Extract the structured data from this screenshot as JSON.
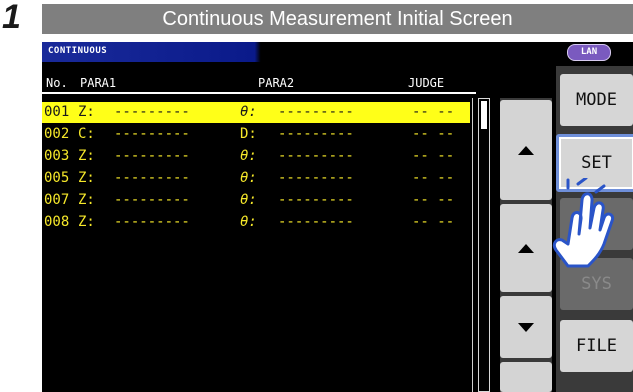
{
  "step": {
    "number": "1",
    "caption": "Continuous Measurement Initial Screen"
  },
  "titlebar": {
    "title": "CONTINUOUS",
    "lan_badge": "LAN"
  },
  "table": {
    "headers": {
      "no": "No.",
      "para1": "PARA1",
      "para2": "PARA2",
      "judge": "JUDGE"
    },
    "rows": [
      {
        "no": "001",
        "p1": "Z:",
        "v1": "---------",
        "p2": "θ:",
        "v2": "---------",
        "j": "-- --",
        "selected": true
      },
      {
        "no": "002",
        "p1": "C:",
        "v1": "---------",
        "p2": "D:",
        "v2": "---------",
        "j": "-- --",
        "selected": false
      },
      {
        "no": "003",
        "p1": "Z:",
        "v1": "---------",
        "p2": "θ:",
        "v2": "---------",
        "j": "-- --",
        "selected": false
      },
      {
        "no": "005",
        "p1": "Z:",
        "v1": "---------",
        "p2": "θ:",
        "v2": "---------",
        "j": "-- --",
        "selected": false
      },
      {
        "no": "007",
        "p1": "Z:",
        "v1": "---------",
        "p2": "θ:",
        "v2": "---------",
        "j": "-- --",
        "selected": false
      },
      {
        "no": "008",
        "p1": "Z:",
        "v1": "---------",
        "p2": "θ:",
        "v2": "---------",
        "j": "-- --",
        "selected": false
      }
    ]
  },
  "side_buttons": {
    "mode": "MODE",
    "set": "SET",
    "sys": "SYS",
    "file": "FILE"
  },
  "icons": {
    "up": "arrow-up-icon",
    "down": "arrow-down-icon",
    "pointer": "hand-pointer-icon"
  },
  "colors": {
    "row_text": "#f6e82a",
    "selected_row": "#ffff18",
    "accent_set": "#6f8fd9"
  }
}
